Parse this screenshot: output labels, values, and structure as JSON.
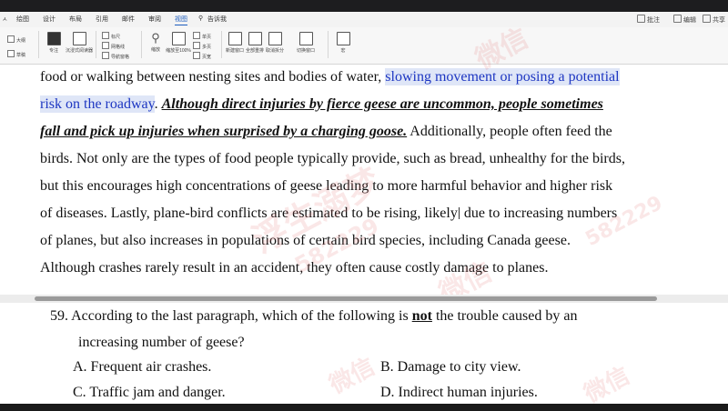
{
  "ribbon": {
    "tabs": [
      "绘图",
      "设计",
      "布局",
      "引用",
      "邮件",
      "审阅",
      "视图",
      "告诉我"
    ],
    "active_tab": "视图",
    "right_buttons": [
      "批注",
      "编辑",
      "共享"
    ],
    "tools": {
      "outline": "大纲",
      "draft": "草稿",
      "focus": "专注",
      "immersive_reader": "沉浸式阅读器",
      "ruler": "标尺",
      "gridlines": "网格线",
      "nav_pane": "导航窗格",
      "zoom": "缩放",
      "zoom_100": "缩放至100%",
      "one_page": "单页",
      "multi_page": "多页",
      "page_width": "页宽",
      "new_window": "新建窗口",
      "arrange_all": "全部重排",
      "split": "取消拆分",
      "switch_window": "切换窗口",
      "macros": "宏"
    }
  },
  "document": {
    "line1_before": "food or walking between nesting sites and bodies of water, ",
    "line1_hl": "slowing movement or posing a potential",
    "line2_hl": "risk on the roadway",
    "line2_after_hl": ". ",
    "line2_bold": "Although direct injuries by fierce geese are uncommon, people sometimes",
    "line3_bold": "fall and pick up injuries when surprised by a charging goose.",
    "line3_after": " Additionally, people often feed the",
    "line4": "birds. Not only are the types of food people typically provide, such as bread, unhealthy for the birds,",
    "line5": "but this encourages high concentrations of geese leading to more harmful behavior and higher risk",
    "line6_before": "of diseases. Lastly, plane-bird conflicts are estimated to be rising, likely",
    "line6_after": " due to increasing numbers",
    "line7": "of planes, but also increases in populations of certain bird species, including Canada geese.",
    "line8": "Although crashes rarely result in an accident, they often cause costly damage to planes."
  },
  "question": {
    "number": "59.",
    "stem_before": "According to the last paragraph, which of the following is ",
    "stem_emph": "not",
    "stem_after": " the trouble caused by an",
    "stem_line2": "increasing number of geese?",
    "options": [
      "A. Frequent air crashes.",
      "B. Damage to city view.",
      "C. Traffic jam and danger.",
      "D. Indirect human injuries."
    ]
  },
  "watermark": {
    "text_a": "微信",
    "text_b": "浮生溺梦",
    "text_c": "582229"
  },
  "colors": {
    "highlight_bg": "#dfe6f7",
    "highlight_text": "#1d36c2",
    "ribbon_accent": "#1f5fbf"
  }
}
